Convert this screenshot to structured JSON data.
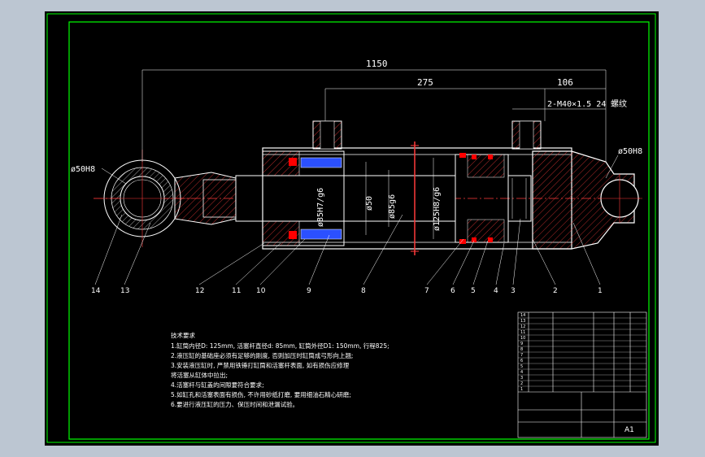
{
  "colors": {
    "background": "#000000",
    "outline": "#ffffff",
    "frame": "#00ff00",
    "centerline": "#ff3b3b",
    "seal_red": "#ff0000",
    "seal_blue": "#2b50ff",
    "viewport_border": "#bcc6d2"
  },
  "dimensions": {
    "overall_length": "1150",
    "stroke_section": "275",
    "end_section": "106",
    "port_thread": "2-M40×1.5 24",
    "port_thread_note": "螺纹",
    "pin_hole_left": "ø50H8",
    "pin_hole_right": "ø50H8",
    "rod_fit": "ø85H7/g6",
    "rod_dia": "ø50",
    "rod_fit2": "ø85g6",
    "bore_fit": "ø125H8/g6"
  },
  "part_labels": [
    "14",
    "13",
    "12",
    "11",
    "10",
    "9",
    "8",
    "7",
    "6",
    "5",
    "4",
    "3",
    "2",
    "1"
  ],
  "technical_requirements": {
    "title": "技术要求",
    "lines": [
      "1.缸筒内径D: 125mm, 活塞杆直径d: 85mm, 缸筒外径D1: 150mm, 行程825;",
      "2.液压缸的基础座必须有足够的刚度, 否则加压时缸筒成弓形向上翘;",
      "3.安装液压缸时, 严禁用铁锤打缸筒和活塞杆表面, 如有损伤应修理",
      "  将活塞从缸体中拉出;",
      "4.活塞杆与缸盖的间隙要符合要求;",
      "5.如缸孔和活塞表面有损伤, 不许用砂纸打磨, 要用细油石精心研磨;",
      "6.要进行液压缸的压力、保压时间和泄漏试验。"
    ]
  },
  "title_block": {
    "rows": [
      "14",
      "13",
      "12",
      "11",
      "10",
      "9",
      "8",
      "7",
      "6",
      "5",
      "4",
      "3",
      "2",
      "1"
    ],
    "sheet": "A1"
  }
}
